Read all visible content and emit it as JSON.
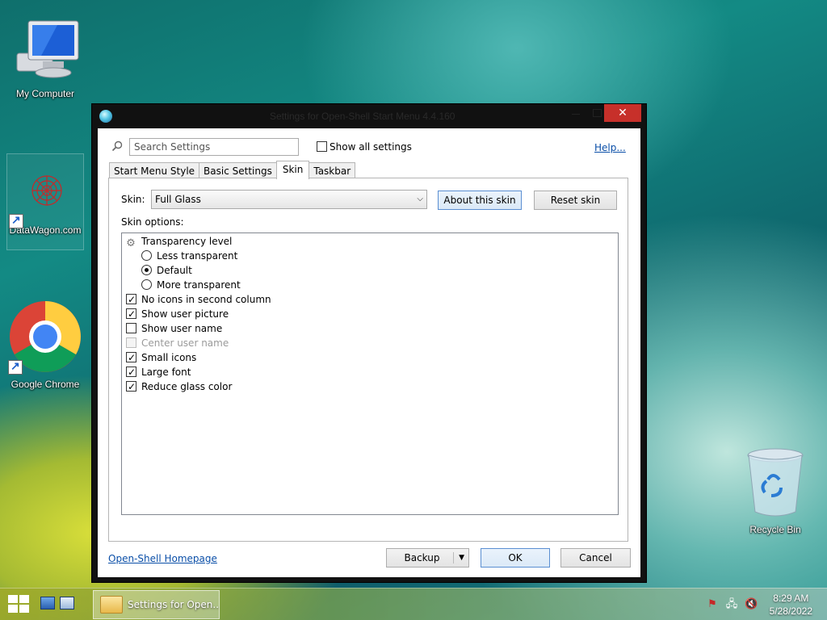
{
  "desktop": {
    "icons": [
      {
        "label": "My Computer",
        "icon": "computer-icon"
      },
      {
        "label": "DataWagon.com",
        "icon": "datawagon-icon"
      },
      {
        "label": "Google Chrome",
        "icon": "chrome-icon"
      },
      {
        "label": "Recycle Bin",
        "icon": "recycle-bin-icon"
      }
    ]
  },
  "window": {
    "title": "Settings for Open-Shell Start Menu 4.4.160",
    "controls": {
      "close": "✕"
    }
  },
  "toolbar": {
    "search_placeholder": "Search Settings",
    "show_all_label": "Show all settings",
    "show_all_checked": false,
    "help_label": "Help..."
  },
  "tabs": [
    {
      "label": "Start Menu Style",
      "active": false
    },
    {
      "label": "Basic Settings",
      "active": false
    },
    {
      "label": "Skin",
      "active": true
    },
    {
      "label": "Taskbar",
      "active": false
    }
  ],
  "skin": {
    "label": "Skin:",
    "selected": "Full Glass",
    "about_label": "About this skin",
    "reset_label": "Reset skin",
    "options_label": "Skin options:"
  },
  "options": [
    {
      "type": "group",
      "label": "Transparency level"
    },
    {
      "type": "radio",
      "label": "Less transparent",
      "checked": false
    },
    {
      "type": "radio",
      "label": "Default",
      "checked": true
    },
    {
      "type": "radio",
      "label": "More transparent",
      "checked": false
    },
    {
      "type": "check",
      "label": "No icons in second column",
      "checked": true
    },
    {
      "type": "check",
      "label": "Show user picture",
      "checked": true
    },
    {
      "type": "check",
      "label": "Show user name",
      "checked": false
    },
    {
      "type": "check",
      "label": "Center user name",
      "checked": false,
      "disabled": true
    },
    {
      "type": "check",
      "label": "Small icons",
      "checked": true
    },
    {
      "type": "check",
      "label": "Large font",
      "checked": true
    },
    {
      "type": "check",
      "label": "Reduce glass color",
      "checked": true
    }
  ],
  "footer": {
    "homepage_label": "Open-Shell Homepage",
    "backup_label": "Backup",
    "ok_label": "OK",
    "cancel_label": "Cancel"
  },
  "taskbar": {
    "task_label": "Settings for Open...",
    "time": "8:29 AM",
    "date": "5/28/2022"
  }
}
